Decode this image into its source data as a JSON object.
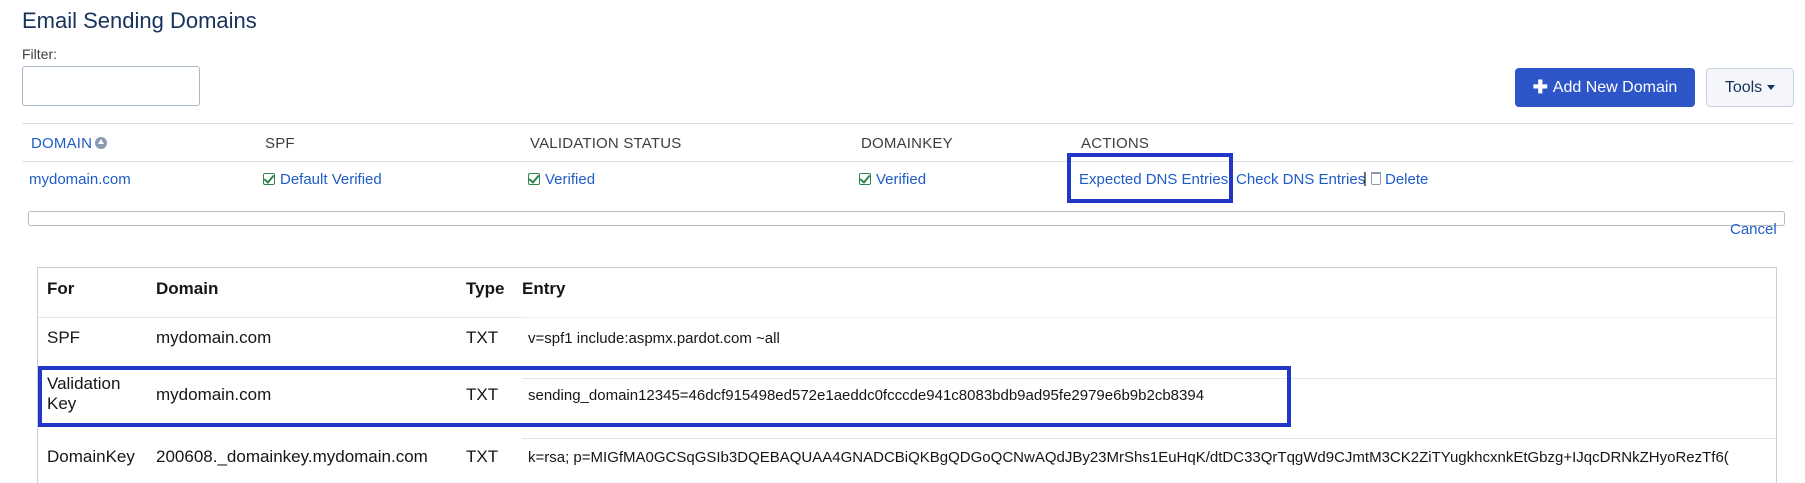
{
  "page": {
    "title": "Email Sending Domains",
    "filter_label": "Filter:",
    "filter_value": ""
  },
  "toolbar": {
    "add_domain_label": "Add New Domain",
    "add_domain_icon": "plus-icon",
    "tools_label": "Tools",
    "accent_color": "#2e55c8"
  },
  "domains_table": {
    "headers": {
      "domain": "DOMAIN",
      "spf": "SPF",
      "validation_status": "VALIDATION STATUS",
      "domainkey": "DOMAINKEY",
      "actions": "ACTIONS"
    },
    "rows": [
      {
        "domain": "mydomain.com",
        "spf": "Default Verified",
        "validation_status": "Verified",
        "domainkey": "Verified",
        "actions": {
          "expected": "Expected DNS Entries",
          "check": "Check DNS Entries",
          "separator": "|",
          "delete": "Delete"
        }
      }
    ]
  },
  "cancel_label": "Cancel",
  "dns_table": {
    "headers": {
      "for": "For",
      "domain": "Domain",
      "type": "Type",
      "entry": "Entry"
    },
    "rows": [
      {
        "for": "SPF",
        "domain": "mydomain.com",
        "type": "TXT",
        "entry": "v=spf1 include:aspmx.pardot.com ~all"
      },
      {
        "for_line1": "Validation",
        "for_line2": "Key",
        "domain": "mydomain.com",
        "type": "TXT",
        "entry": "sending_domain12345=46dcf915498ed572e1aeddc0fcccde941c8083bdb9ad95fe2979e6b9b2cb8394"
      },
      {
        "for": "DomainKey",
        "domain": "200608._domainkey.mydomain.com",
        "type": "TXT",
        "entry": "k=rsa; p=MIGfMA0GCSqGSIb3DQEBAQUAA4GNADCBiQKBgQDGoQCNwAQdJBy23MrShs1EuHqK/dtDC33QrTqgWd9CJmtM3CK2ZiTYugkhcxnkEtGbzg+IJqcDRNkZHyoRezTf6("
      }
    ]
  },
  "highlight_color": "#2236c8"
}
